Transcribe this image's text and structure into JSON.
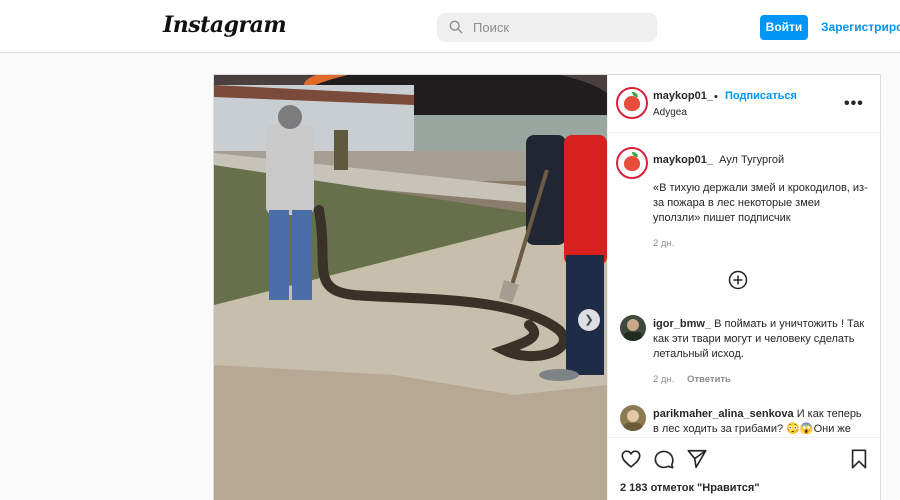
{
  "header": {
    "logo": "Instagram",
    "search_placeholder": "Поиск",
    "login_label": "Войти",
    "register_label": "Зарегистрироваться"
  },
  "post": {
    "author": "maykop01_",
    "separator": "•",
    "follow_label": "Подписаться",
    "location": "Adygea",
    "caption": {
      "username": "maykop01_",
      "headline": "Аул Тугургой",
      "text": "«В тихую держали змей и крокодилов, из-за пожара в лес некоторые змеи уползли» пишет подписчик",
      "time": "2 дн."
    },
    "comments": [
      {
        "username": "igor_bmw_",
        "text": "В поймать и уничтожить ! Так как эти твари могут и человеку сделать летальный исход.",
        "time": "2 дн.",
        "reply_label": "Ответить"
      },
      {
        "username": "parikmaher_alina_senkova",
        "text": "И как теперь в лес ходить за грибами? 😳😱Они же"
      }
    ],
    "likes_text": "2 183 отметок \"Нравится\""
  },
  "colors": {
    "accent": "#0095f6",
    "border": "#dbdbdb",
    "background": "#fafafa",
    "avatar_ring": "#d8203b"
  },
  "icons": [
    "search-icon",
    "more-options-icon",
    "add-comment-icon",
    "carousel-next-icon",
    "heart-icon",
    "comment-icon",
    "share-icon",
    "bookmark-icon"
  ]
}
